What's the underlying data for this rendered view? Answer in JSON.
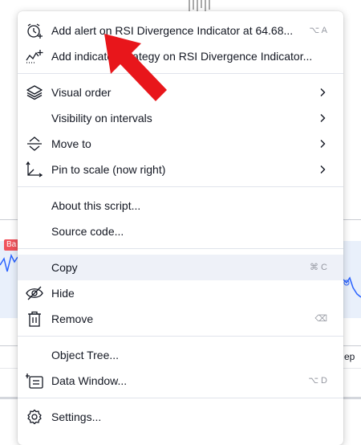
{
  "background": {
    "series_badge": "Ba",
    "axis_label": "ep"
  },
  "menu": {
    "groups": [
      {
        "items": [
          {
            "label": "Add alert on RSI Divergence Indicator at 64.68...",
            "shortcut": "⌥ A",
            "icon": "alarm-plus-icon"
          },
          {
            "label": "Add indicator/strategy on RSI Divergence Indicator...",
            "icon": "indicator-add-icon"
          }
        ]
      },
      {
        "items": [
          {
            "label": "Visual order",
            "icon": "layers-icon",
            "submenu": true
          },
          {
            "label": "Visibility on intervals",
            "submenu": true
          },
          {
            "label": "Move to",
            "icon": "move-icon",
            "submenu": true
          },
          {
            "label": "Pin to scale (now right)",
            "icon": "pin-scale-icon",
            "submenu": true
          }
        ]
      },
      {
        "items": [
          {
            "label": "About this script..."
          },
          {
            "label": "Source code..."
          }
        ]
      },
      {
        "items": [
          {
            "label": "Copy",
            "shortcut": "⌘ C",
            "hovered": true
          },
          {
            "label": "Hide",
            "icon": "eye-off-icon"
          },
          {
            "label": "Remove",
            "icon": "trash-icon",
            "shortcut": "⌫"
          }
        ]
      },
      {
        "items": [
          {
            "label": "Object Tree..."
          },
          {
            "label": "Data Window...",
            "icon": "data-window-icon",
            "shortcut": "⌥ D"
          }
        ]
      },
      {
        "items": [
          {
            "label": "Settings...",
            "icon": "gear-icon"
          }
        ]
      }
    ]
  },
  "colors": {
    "annotation_arrow": "#e8161b",
    "hover_bg": "#eef1f8",
    "text": "#131722",
    "shortcut": "#9598a1"
  }
}
